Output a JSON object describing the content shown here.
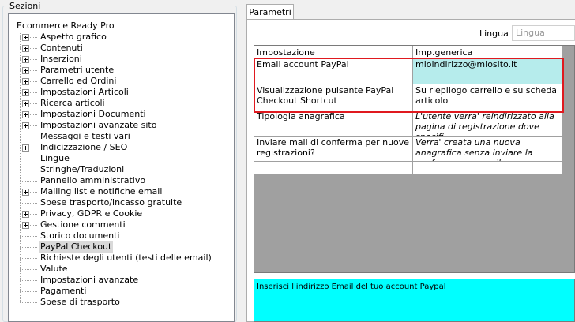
{
  "sections": {
    "title": "Sezioni",
    "root": "Ecommerce Ready Pro",
    "items": [
      {
        "label": "Aspetto grafico",
        "expandable": true
      },
      {
        "label": "Contenuti",
        "expandable": true
      },
      {
        "label": "Inserzioni",
        "expandable": true
      },
      {
        "label": "Parametri utente",
        "expandable": true
      },
      {
        "label": "Carrello ed Ordini",
        "expandable": true
      },
      {
        "label": "Impostazioni Articoli",
        "expandable": true
      },
      {
        "label": "Ricerca articoli",
        "expandable": true
      },
      {
        "label": "Impostazioni Documenti",
        "expandable": true
      },
      {
        "label": "Impostazioni avanzate sito",
        "expandable": true
      },
      {
        "label": "Messaggi e testi vari",
        "expandable": false
      },
      {
        "label": "Indicizzazione / SEO",
        "expandable": true
      },
      {
        "label": "Lingue",
        "expandable": false
      },
      {
        "label": "Stringhe/Traduzioni",
        "expandable": false
      },
      {
        "label": "Pannello amministrativo",
        "expandable": false
      },
      {
        "label": "Mailing list e notifiche email",
        "expandable": true
      },
      {
        "label": "Spese trasporto/incasso gratuite",
        "expandable": false
      },
      {
        "label": "Privacy, GDPR e Cookie",
        "expandable": true
      },
      {
        "label": "Gestione commenti",
        "expandable": true
      },
      {
        "label": "Storico documenti",
        "expandable": false
      },
      {
        "label": "PayPal Checkout",
        "expandable": false,
        "selected": true
      },
      {
        "label": "Richieste degli utenti (testi delle email)",
        "expandable": false
      },
      {
        "label": "Valute",
        "expandable": false
      },
      {
        "label": "Impostazioni avanzate",
        "expandable": false
      },
      {
        "label": "Pagamenti",
        "expandable": false
      },
      {
        "label": "Spese di trasporto",
        "expandable": false
      }
    ]
  },
  "panel": {
    "tab_label": "Parametri",
    "language_label": "Lingua :",
    "language_value": "Lingua default"
  },
  "grid": {
    "headers": [
      "Impostazione",
      "Imp.generica"
    ],
    "rows": [
      {
        "setting": "Email account PayPal",
        "value": "mioindirizzo@miosito.it"
      },
      {
        "setting": "Visualizzazione pulsante PayPal Checkout Shortcut",
        "value": "Su riepilogo carrello e su scheda articolo"
      },
      {
        "setting": "Tipologia anagrafica",
        "value": "L'utente verra' reindirizzato alla pagina di registrazione dove specifi..."
      },
      {
        "setting": "Inviare mail di conferma per nuove registrazioni?",
        "value": "Verra' creata una nuova anagrafica senza inviare la conferma per email..."
      },
      {
        "setting": "",
        "value": ""
      }
    ]
  },
  "description": "Inserisci l'indirizzo Email del tuo account Paypal",
  "colors": {
    "highlight": "#e0191f",
    "edit_cell": "#b6ecec",
    "description_bg": "#00ffff"
  }
}
